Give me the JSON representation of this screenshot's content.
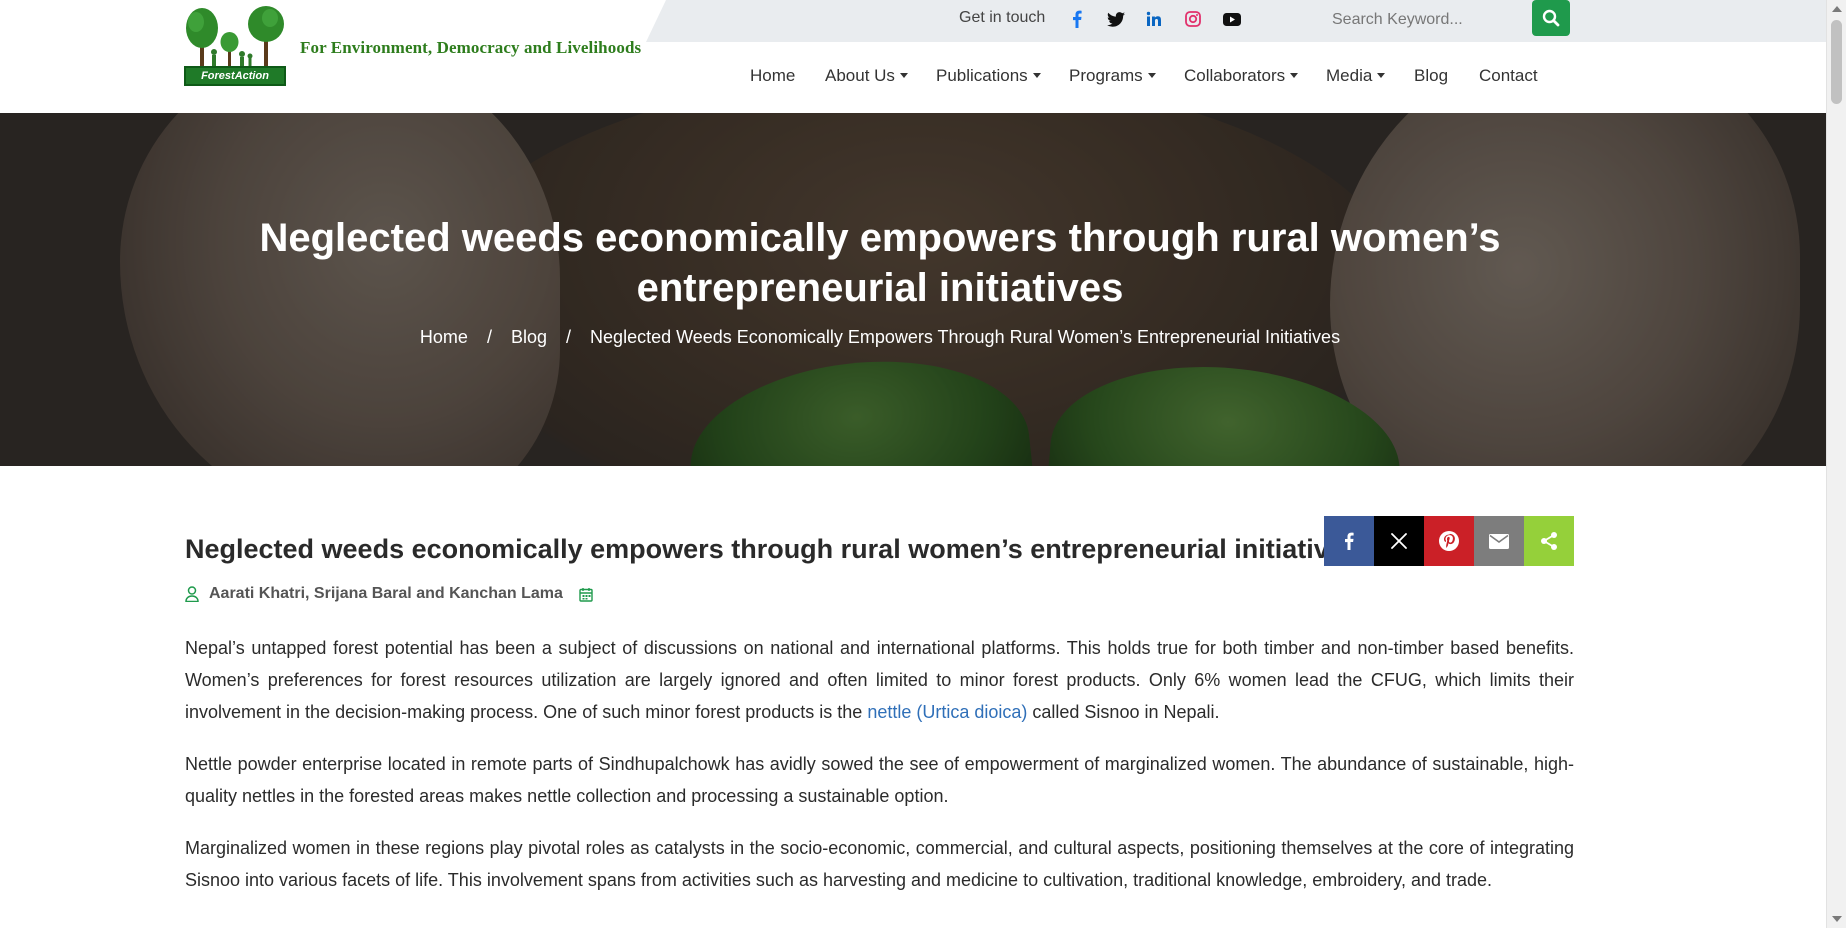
{
  "brand": {
    "logo_text": "ForestAction",
    "tagline": "For Environment, Democracy and Livelihoods"
  },
  "topbar": {
    "get_in_touch": "Get in touch",
    "social": [
      {
        "icon": "facebook-icon",
        "color": "#1877f2"
      },
      {
        "icon": "twitter-icon",
        "color": "#111111"
      },
      {
        "icon": "linkedin-icon",
        "color": "#0a66c2"
      },
      {
        "icon": "instagram-icon",
        "color": "#e1306c"
      },
      {
        "icon": "youtube-icon",
        "color": "#111111"
      }
    ],
    "search_placeholder": "Search Keyword..."
  },
  "nav": {
    "items": [
      {
        "label": "Home",
        "dropdown": false
      },
      {
        "label": "About Us",
        "dropdown": true
      },
      {
        "label": "Publications",
        "dropdown": true
      },
      {
        "label": "Programs",
        "dropdown": true
      },
      {
        "label": "Collaborators",
        "dropdown": true
      },
      {
        "label": "Media",
        "dropdown": true
      },
      {
        "label": "Blog",
        "dropdown": false
      },
      {
        "label": "Contact",
        "dropdown": false
      }
    ]
  },
  "hero": {
    "title": "Neglected weeds economically empowers through rural women’s entrepreneurial initiatives",
    "breadcrumb": {
      "home": "Home",
      "sep": "/",
      "blog": "Blog",
      "current": "Neglected Weeds Economically Empowers Through Rural Women’s Entrepreneurial Initiatives"
    }
  },
  "article": {
    "title": "Neglected weeds economically empowers through rural women’s entrepreneurial initiatives",
    "authors": "Aarati Khatri, Srijana Baral and Kanchan Lama",
    "share": [
      {
        "icon": "facebook-share-icon",
        "color": "#3b5998"
      },
      {
        "icon": "x-share-icon",
        "color": "#000000"
      },
      {
        "icon": "pinterest-share-icon",
        "color": "#cb2027"
      },
      {
        "icon": "email-share-icon",
        "color": "#7d7d7d"
      },
      {
        "icon": "share-icon",
        "color": "#95d03a"
      }
    ],
    "p1_before": "Nepal’s untapped forest potential has been a subject of discussions on national and international platforms. This holds true for both timber and non-timber based benefits. Women’s preferences for forest resources utilization are largely ignored and often limited to minor forest products. Only 6% women lead the CFUG, which limits their involvement in the decision-making process. One of such minor forest products is the ",
    "p1_link": "nettle (Urtica dioica)",
    "p1_after": " called Sisnoo in Nepali.",
    "p2": "Nettle powder enterprise located in remote parts of Sindhupalchowk has avidly sowed the see of empowerment of marginalized women. The abundance of sustainable, high-quality nettles in the forested areas makes nettle collection and processing a sustainable option.",
    "p3": "Marginalized women in these regions play pivotal roles as catalysts in the socio-economic, commercial, and cultural aspects, positioning themselves at the core of integrating Sisnoo into various facets of life. This involvement spans from activities such as harvesting and medicine to cultivation, traditional knowledge, embroidery, and trade."
  },
  "colors": {
    "brand_green": "#2e7d1d",
    "accent_green": "#1f9a4c",
    "link_blue": "#2f6fb8"
  }
}
